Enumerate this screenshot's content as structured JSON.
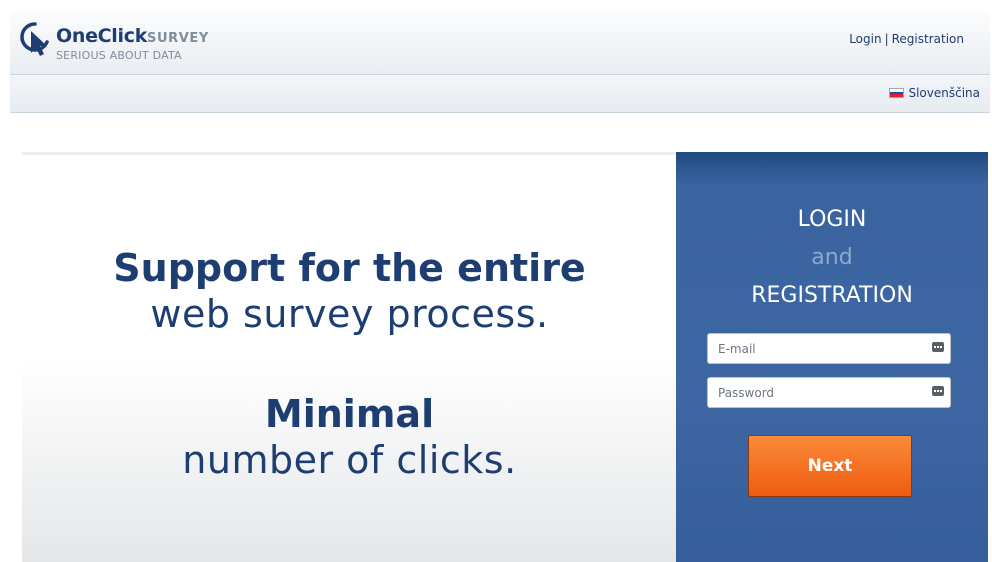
{
  "header": {
    "logo_name": "OneClick",
    "logo_name_suffix": "SURVEY",
    "logo_tagline": "SERIOUS ABOUT DATA",
    "login_link": "Login",
    "separator": "|",
    "registration_link": "Registration"
  },
  "language": {
    "label": "Slovenščina",
    "flag_colors": [
      "#ffffff",
      "#1e4fb0",
      "#e0212a"
    ]
  },
  "hero": {
    "line1_bold": "Support for the entire",
    "line1_light": "web survey process.",
    "line2_bold": "Minimal",
    "line2_light": "number of clicks."
  },
  "panel": {
    "title_login": "LOGIN",
    "title_and": "and",
    "title_registration": "REGISTRATION",
    "email_placeholder": "E-mail",
    "password_placeholder": "Password",
    "next_label": "Next"
  },
  "colors": {
    "brand_navy": "#1e3e72",
    "panel_blue": "#3d66a2",
    "accent_orange": "#f5741f"
  }
}
